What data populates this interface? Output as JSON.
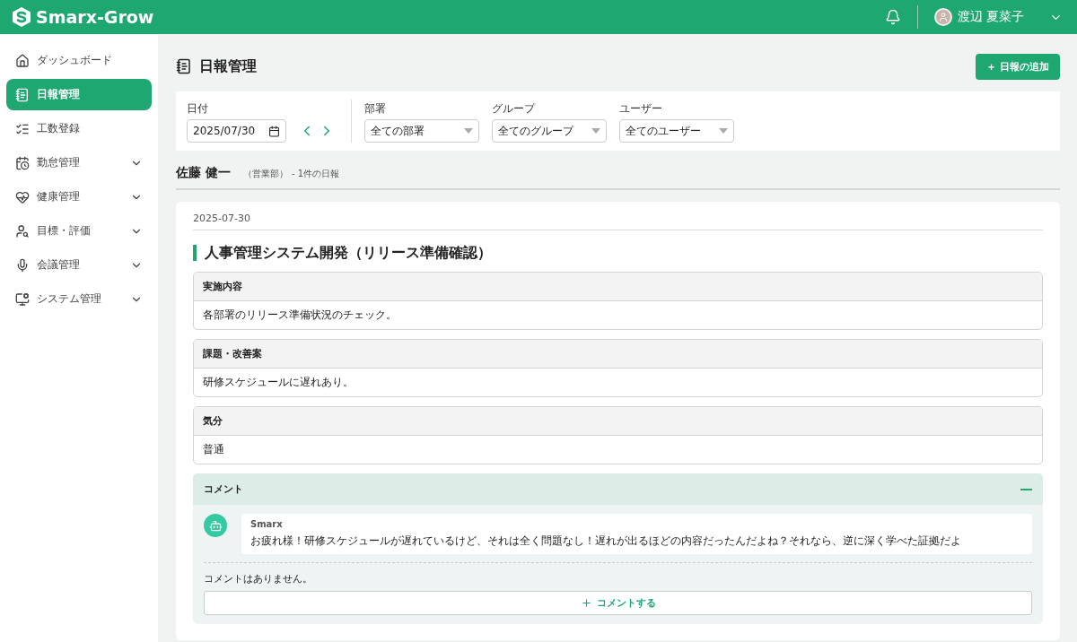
{
  "header": {
    "brand": "Smarx-Grow",
    "user_name": "渡辺 夏菜子"
  },
  "sidebar": {
    "items": [
      {
        "label": "ダッシュボード",
        "selected": false,
        "expandable": false
      },
      {
        "label": "日報管理",
        "selected": true,
        "expandable": false
      },
      {
        "label": "工数登録",
        "selected": false,
        "expandable": false
      },
      {
        "label": "勤怠管理",
        "selected": false,
        "expandable": true
      },
      {
        "label": "健康管理",
        "selected": false,
        "expandable": true
      },
      {
        "label": "目標・評価",
        "selected": false,
        "expandable": true
      },
      {
        "label": "会議管理",
        "selected": false,
        "expandable": true
      },
      {
        "label": "システム管理",
        "selected": false,
        "expandable": true
      }
    ]
  },
  "page": {
    "title": "日報管理",
    "add_button": "＋ 日報の追加"
  },
  "filters": {
    "date": {
      "label": "日付",
      "value": "2025/07/30"
    },
    "selects": [
      {
        "label": "部署",
        "value": "全ての部署"
      },
      {
        "label": "グループ",
        "value": "全てのグループ"
      },
      {
        "label": "ユーザー",
        "value": "全てのユーザー"
      }
    ]
  },
  "person": {
    "name": "佐藤 健一",
    "department": "（営業部）",
    "count": "- 1件の日報"
  },
  "report": {
    "date": "2025-07-30",
    "title": "人事管理システム開発（リリース準備確認）",
    "sections": [
      {
        "title": "実施内容",
        "body": "各部署のリリース準備状況のチェック。"
      },
      {
        "title": "課題・改善案",
        "body": "研修スケジュールに遅れあり。"
      },
      {
        "title": "気分",
        "body": "普通"
      }
    ],
    "comments": {
      "title": "コメント",
      "expanded": true,
      "ai_message": {
        "author": "Smarx",
        "text": "お疲れ様！研修スケジュールが遅れているけど、それは全く問題なし！遅れが出るほどの内容だったんだよね？それなら、逆に深く学べた証拠だよ"
      },
      "empty_text": "コメントはありません。",
      "add_button": "コメントする"
    }
  }
}
